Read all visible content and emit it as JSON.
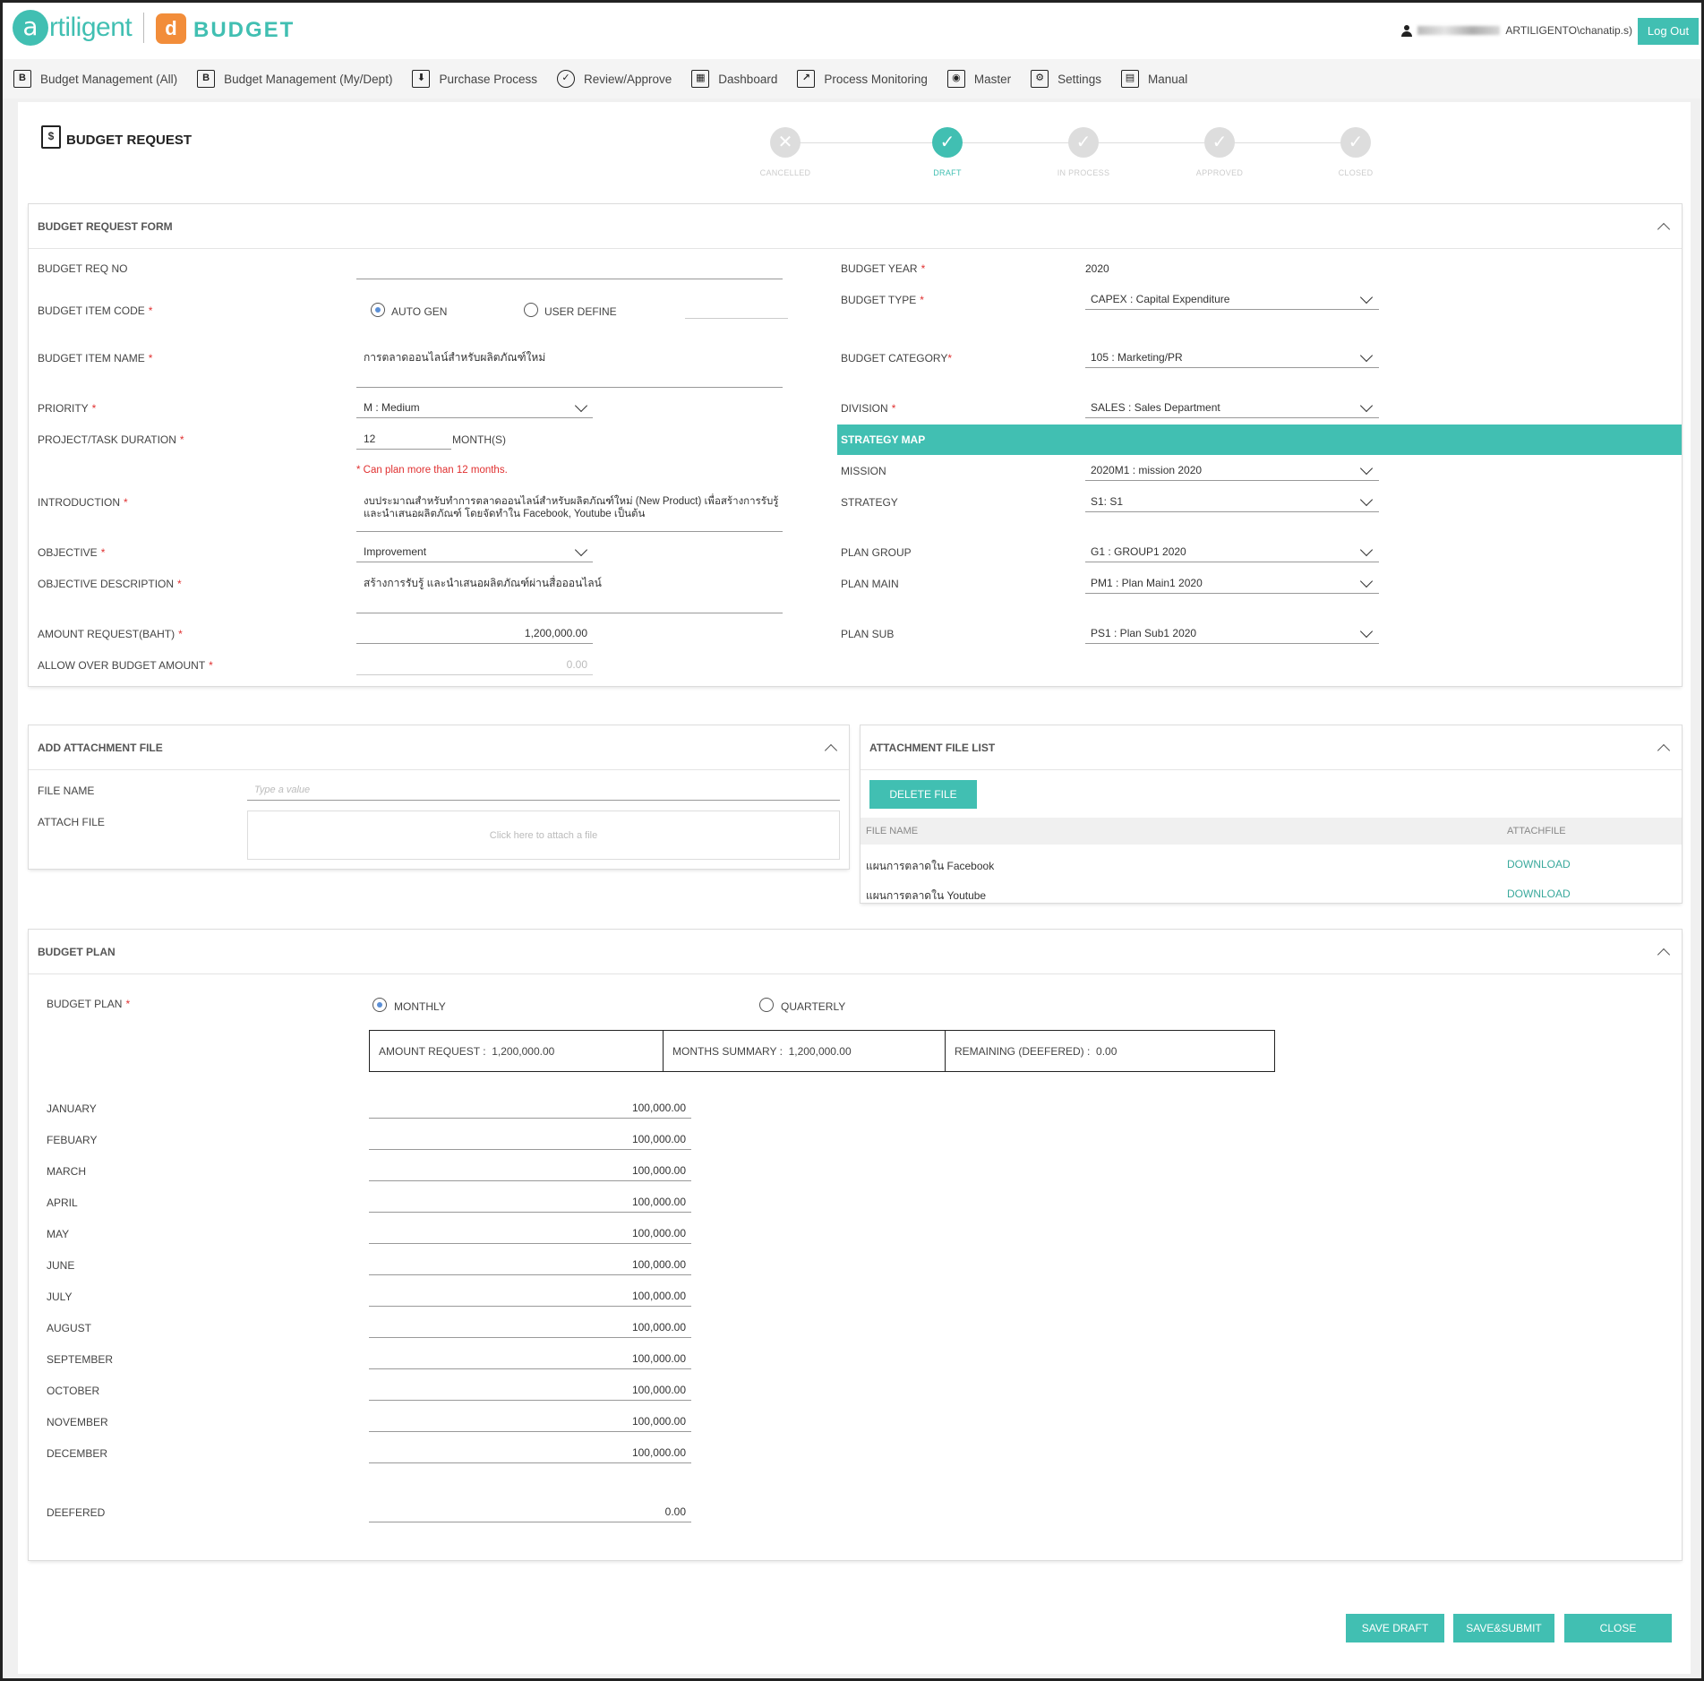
{
  "header": {
    "brand_letter": "a",
    "brand_word": "rtiligent",
    "app_letter": "d",
    "app_name": "BUDGET",
    "user_domain": "ARTILIGENTO\\chanatip.s)",
    "logout_label": "Log Out"
  },
  "menu": [
    {
      "label": "Budget Management (All)",
      "icon": "budget-all-icon",
      "glyph": "B"
    },
    {
      "label": "Budget Management (My/Dept)",
      "icon": "budget-dept-icon",
      "glyph": "B"
    },
    {
      "label": "Purchase Process",
      "icon": "purchase-icon",
      "glyph": "⬇"
    },
    {
      "label": "Review/Approve",
      "icon": "check-circle-icon",
      "glyph": "✓"
    },
    {
      "label": "Dashboard",
      "icon": "dashboard-icon",
      "glyph": "▦"
    },
    {
      "label": "Process Monitoring",
      "icon": "monitoring-icon",
      "glyph": "↗"
    },
    {
      "label": "Master",
      "icon": "master-icon",
      "glyph": "◉"
    },
    {
      "label": "Settings",
      "icon": "settings-icon",
      "glyph": "⚙"
    },
    {
      "label": "Manual",
      "icon": "manual-icon",
      "glyph": "▤"
    }
  ],
  "page": {
    "title": "BUDGET REQUEST",
    "title_icon": "money-document-icon",
    "steps": [
      {
        "label": "CANCELLED",
        "state": "inactive",
        "glyph": "✕"
      },
      {
        "label": "DRAFT",
        "state": "active",
        "glyph": "✓"
      },
      {
        "label": "IN PROCESS",
        "state": "inactive",
        "glyph": "✓"
      },
      {
        "label": "APPROVED",
        "state": "inactive",
        "glyph": "✓"
      },
      {
        "label": "CLOSED",
        "state": "inactive",
        "glyph": "✓"
      }
    ]
  },
  "form": {
    "panel_title": "BUDGET REQUEST FORM",
    "req_no_label": "BUDGET REQ NO",
    "req_no_value": "",
    "item_code_label": "BUDGET ITEM CODE",
    "auto_gen_label": "AUTO GEN",
    "user_define_label": "USER DEFINE",
    "item_name_label": "BUDGET ITEM NAME",
    "item_name_value": "การตลาดออนไลน์สำหรับผลิตภัณฑ์ใหม่",
    "priority_label": "PRIORITY",
    "priority_value": "M : Medium",
    "duration_label": "PROJECT/TASK DURATION",
    "duration_value": "12",
    "duration_unit": "MONTH(S)",
    "duration_hint": "* Can plan more than 12 months.",
    "intro_label": "INTRODUCTION",
    "intro_line1": "งบประมาณสำหรับทำการตลาดออนไลน์สำหรับผลิตภัณฑ์ใหม่ (New Product) เพื่อสร้างการรับรู้",
    "intro_line2": "และนำเสนอผลิตภัณฑ์ โดยจัดทำใน Facebook, Youtube เป็นต้น",
    "objective_label": "OBJECTIVE",
    "objective_value": "Improvement",
    "objective_desc_label": "OBJECTIVE DESCRIPTION",
    "objective_desc_value": "สร้างการรับรู้ และนำเสนอผลิตภัณฑ์ผ่านสื่อออนไลน์",
    "amount_label": "AMOUNT REQUEST(BAHT)",
    "amount_value": "1,200,000.00",
    "allow_over_label": "ALLOW OVER BUDGET AMOUNT",
    "allow_over_value": "0.00",
    "year_label": "BUDGET YEAR",
    "year_value": "2020",
    "type_label": "BUDGET TYPE",
    "type_value": "CAPEX : Capital Expenditure",
    "category_label": "BUDGET CATEGORY",
    "category_value": "105 : Marketing/PR",
    "division_label": "DIVISION",
    "division_value": "SALES : Sales Department",
    "strategy_title": "STRATEGY MAP",
    "mission_label": "MISSION",
    "mission_value": "2020M1 : mission 2020",
    "strategy_label": "STRATEGY",
    "strategy_value": "S1: S1",
    "plan_group_label": "PLAN GROUP",
    "plan_group_value": "G1 : GROUP1 2020",
    "plan_main_label": "PLAN MAIN",
    "plan_main_value": "PM1 : Plan Main1 2020",
    "plan_sub_label": "PLAN SUB",
    "plan_sub_value": "PS1 : Plan Sub1 2020"
  },
  "attach": {
    "panel_title": "ADD ATTACHMENT FILE",
    "file_name_label": "FILE NAME",
    "file_name_placeholder": "Type a value",
    "attach_label": "ATTACH FILE",
    "attach_hint": "Click here to attach a file"
  },
  "file_list": {
    "panel_title": "ATTACHMENT FILE LIST",
    "delete_label": "DELETE FILE",
    "col_name": "FILE NAME",
    "col_attach": "ATTACHFILE",
    "rows": [
      {
        "name": "แผนการตลาดใน Facebook",
        "action": "DOWNLOAD"
      },
      {
        "name": "แผนการตลาดใน Youtube",
        "action": "DOWNLOAD"
      }
    ]
  },
  "plan": {
    "panel_title": "BUDGET PLAN",
    "plan_label": "BUDGET PLAN",
    "monthly_label": "MONTHLY",
    "quarterly_label": "QUARTERLY",
    "summary": {
      "amount_label": "AMOUNT REQUEST :",
      "amount_value": "1,200,000.00",
      "months_label": "MONTHS SUMMARY :",
      "months_value": "1,200,000.00",
      "remaining_label": "REMAINING (DEEFERED) :",
      "remaining_value": "0.00"
    },
    "months": [
      {
        "label": "JANUARY",
        "value": "100,000.00"
      },
      {
        "label": "FEBUARY",
        "value": "100,000.00"
      },
      {
        "label": "MARCH",
        "value": "100,000.00"
      },
      {
        "label": "APRIL",
        "value": "100,000.00"
      },
      {
        "label": "MAY",
        "value": "100,000.00"
      },
      {
        "label": "JUNE",
        "value": "100,000.00"
      },
      {
        "label": "JULY",
        "value": "100,000.00"
      },
      {
        "label": "AUGUST",
        "value": "100,000.00"
      },
      {
        "label": "SEPTEMBER",
        "value": "100,000.00"
      },
      {
        "label": "OCTOBER",
        "value": "100,000.00"
      },
      {
        "label": "NOVEMBER",
        "value": "100,000.00"
      },
      {
        "label": "DECEMBER",
        "value": "100,000.00"
      }
    ],
    "deefered_label": "DEEFERED",
    "deefered_value": "0.00"
  },
  "actions": {
    "save_draft": "SAVE DRAFT",
    "save_submit": "SAVE&SUBMIT",
    "close": "CLOSE"
  },
  "colors": {
    "accent": "#41bfb2",
    "brand_orange": "#f28d3a",
    "required": "#e03030"
  }
}
